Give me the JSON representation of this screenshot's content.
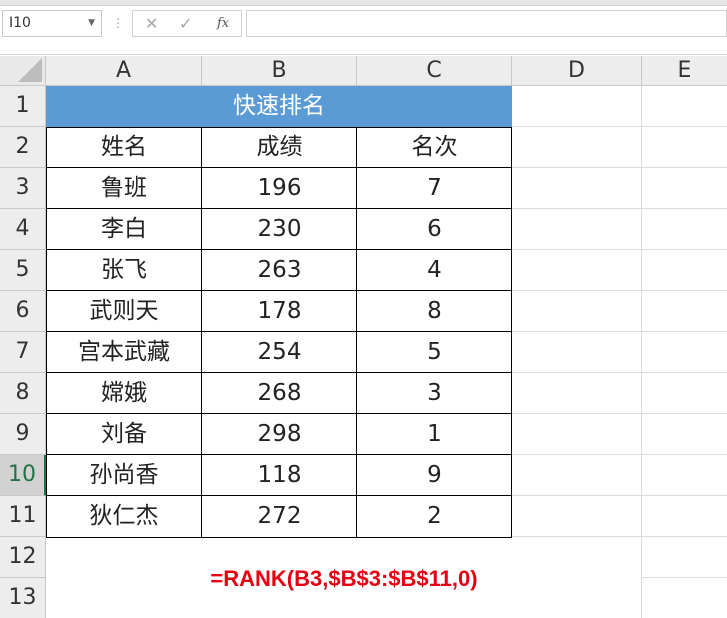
{
  "formula_bar": {
    "name_box": "I10",
    "cancel_icon": "✕",
    "enter_icon": "✓",
    "fx_label": "fx",
    "formula_value": ""
  },
  "columns": [
    "A",
    "B",
    "C",
    "D",
    "E"
  ],
  "rows": [
    "1",
    "2",
    "3",
    "4",
    "5",
    "6",
    "7",
    "8",
    "9",
    "10",
    "11",
    "12",
    "13"
  ],
  "active_row": "10",
  "colors": {
    "title_fill": "#5b9bd5",
    "formula_text": "#e60012",
    "active_header": "#217346"
  },
  "table": {
    "title": "快速排名",
    "headers": [
      "姓名",
      "成绩",
      "名次"
    ],
    "rows": [
      [
        "鲁班",
        "196",
        "7"
      ],
      [
        "李白",
        "230",
        "6"
      ],
      [
        "张飞",
        "263",
        "4"
      ],
      [
        "武则天",
        "178",
        "8"
      ],
      [
        "宫本武藏",
        "254",
        "5"
      ],
      [
        "嫦娥",
        "268",
        "3"
      ],
      [
        "刘备",
        "298",
        "1"
      ],
      [
        "孙尚香",
        "118",
        "9"
      ],
      [
        "狄仁杰",
        "272",
        "2"
      ]
    ]
  },
  "formula_note": "=RANK(B3,$B$3:$B$11,0)"
}
